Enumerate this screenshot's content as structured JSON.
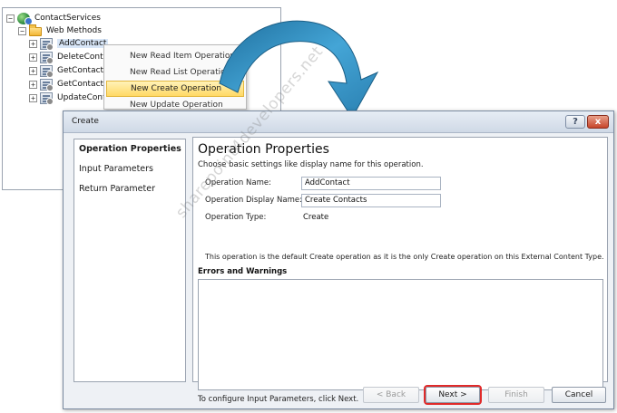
{
  "explorer": {
    "root": {
      "label": "ContactServices",
      "toggle": "−"
    },
    "folder": {
      "label": "Web Methods",
      "toggle": "−"
    },
    "methods": [
      {
        "label": "AddContact",
        "toggle": "+"
      },
      {
        "label": "DeleteConta",
        "toggle": "+"
      },
      {
        "label": "GetContactI",
        "toggle": "+"
      },
      {
        "label": "GetContacts",
        "toggle": "+"
      },
      {
        "label": "UpdateCont",
        "toggle": "+"
      }
    ]
  },
  "context_menu": {
    "items": [
      {
        "label": "New Read Item Operation"
      },
      {
        "label": "New Read List Operation"
      },
      {
        "label": "New Create Operation"
      },
      {
        "label": "New Update Operation"
      }
    ]
  },
  "dialog": {
    "title": "Create",
    "help_label": "?",
    "close_label": "x",
    "nav": [
      {
        "label": "Operation Properties"
      },
      {
        "label": "Input Parameters"
      },
      {
        "label": "Return Parameter"
      }
    ],
    "heading": "Operation Properties",
    "subheading": "Choose basic settings like display name for this operation.",
    "fields": {
      "name_label": "Operation Name:",
      "name_value": "AddContact",
      "display_label": "Operation Display Name:",
      "display_value": "Create Contacts",
      "type_label": "Operation Type:",
      "type_value": "Create"
    },
    "info": "This operation is the default Create operation as it is the only Create operation on this External Content Type.",
    "errors_title": "Errors and Warnings",
    "footer": "To configure Input Parameters, click Next.",
    "buttons": {
      "back": "< Back",
      "next": "Next >",
      "finish": "Finish",
      "cancel": "Cancel"
    }
  },
  "watermark": "sharepoint4developers.net",
  "colors": {
    "arrow": "#2f86b8",
    "menu_highlight": "#ffd965",
    "next_outline": "#e02a2a"
  }
}
